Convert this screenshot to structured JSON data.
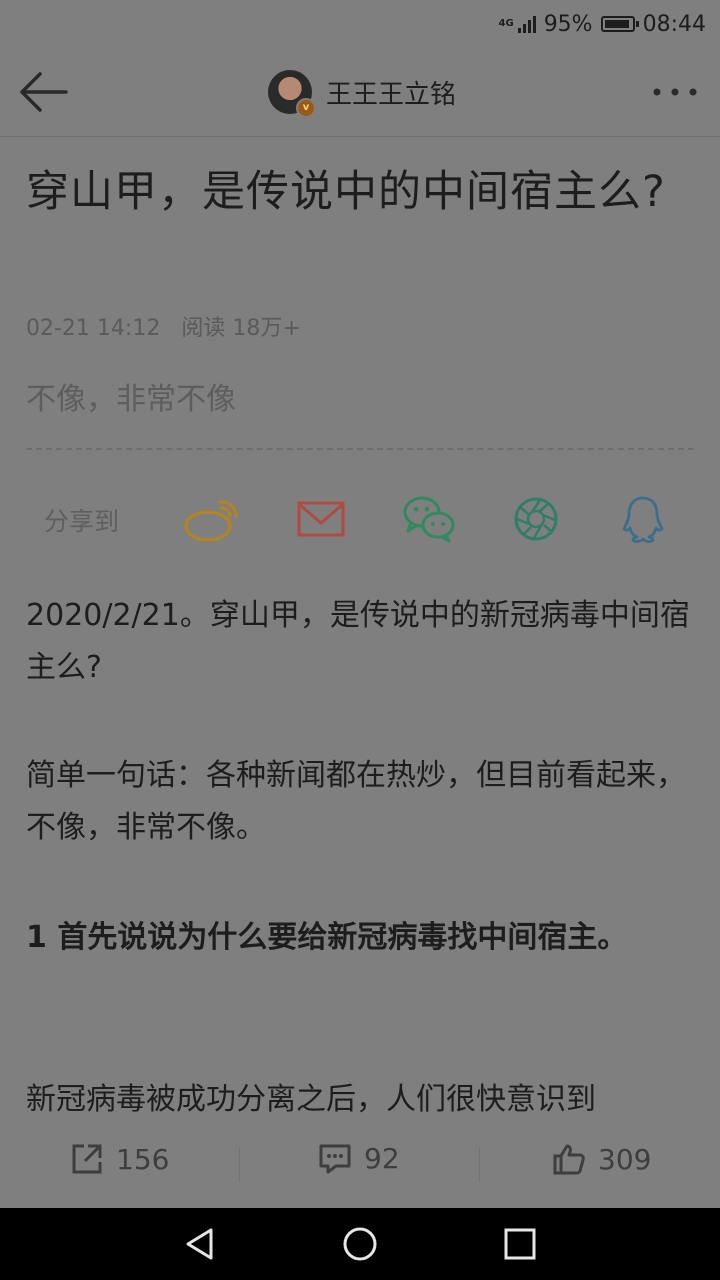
{
  "status": {
    "network": "4G",
    "battery": "95%",
    "battery_level": 0.95,
    "time": "08:44"
  },
  "topbar": {
    "author": "王王王立铭",
    "avatar_badge": "v"
  },
  "article": {
    "title": "穿山甲，是传说中的中间宿主么?",
    "date": "02-21 14:12",
    "reads": "阅读 18万+",
    "summary": "不像，非常不像",
    "share_label": "分享到",
    "paragraphs": [
      "2020/2/21。穿山甲，是传说中的新冠病毒中间宿主么?",
      "简单一句话：各种新闻都在热炒，但目前看起来，不像，非常不像。",
      "1 首先说说为什么要给新冠病毒找中间宿主。",
      "新冠病毒被成功分离之后，人们很快意识到"
    ]
  },
  "share_targets": [
    {
      "name": "weibo",
      "icon": "weibo-icon",
      "color": "#b5841f"
    },
    {
      "name": "email",
      "icon": "mail-icon",
      "color": "#b04a42"
    },
    {
      "name": "wechat",
      "icon": "wechat-icon",
      "color": "#2f8a5e"
    },
    {
      "name": "moments",
      "icon": "moments-icon",
      "color": "#2f7d6a"
    },
    {
      "name": "qq",
      "icon": "qq-icon",
      "color": "#3a6e8c"
    }
  ],
  "footer": {
    "reposts": "156",
    "comments": "92",
    "likes": "309"
  },
  "colors": {
    "overlay_bg": "#7f7f7f",
    "text": "#1d1d1d",
    "muted": "#5a5a5a",
    "navbar": "#000000"
  }
}
